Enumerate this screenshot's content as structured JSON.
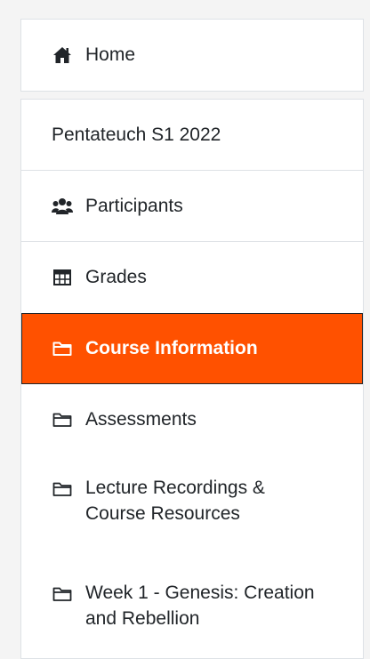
{
  "nav": {
    "home": {
      "label": "Home",
      "icon": "home-icon"
    },
    "course_title": "Pentateuch S1 2022",
    "items": [
      {
        "label": "Participants",
        "icon": "users-icon"
      },
      {
        "label": "Grades",
        "icon": "table-icon"
      },
      {
        "label": "Course Information",
        "icon": "folder-icon",
        "active": true
      },
      {
        "label": "Assessments",
        "icon": "folder-icon"
      },
      {
        "label": "Lecture Recordings & Course Resources",
        "icon": "folder-icon"
      },
      {
        "label": "Week 1 - Genesis: Creation and Rebellion",
        "icon": "folder-icon"
      }
    ]
  },
  "colors": {
    "active_background": "#ff5100",
    "text": "#212529",
    "border": "#dee2e6",
    "page_background": "#f4f4f4"
  }
}
